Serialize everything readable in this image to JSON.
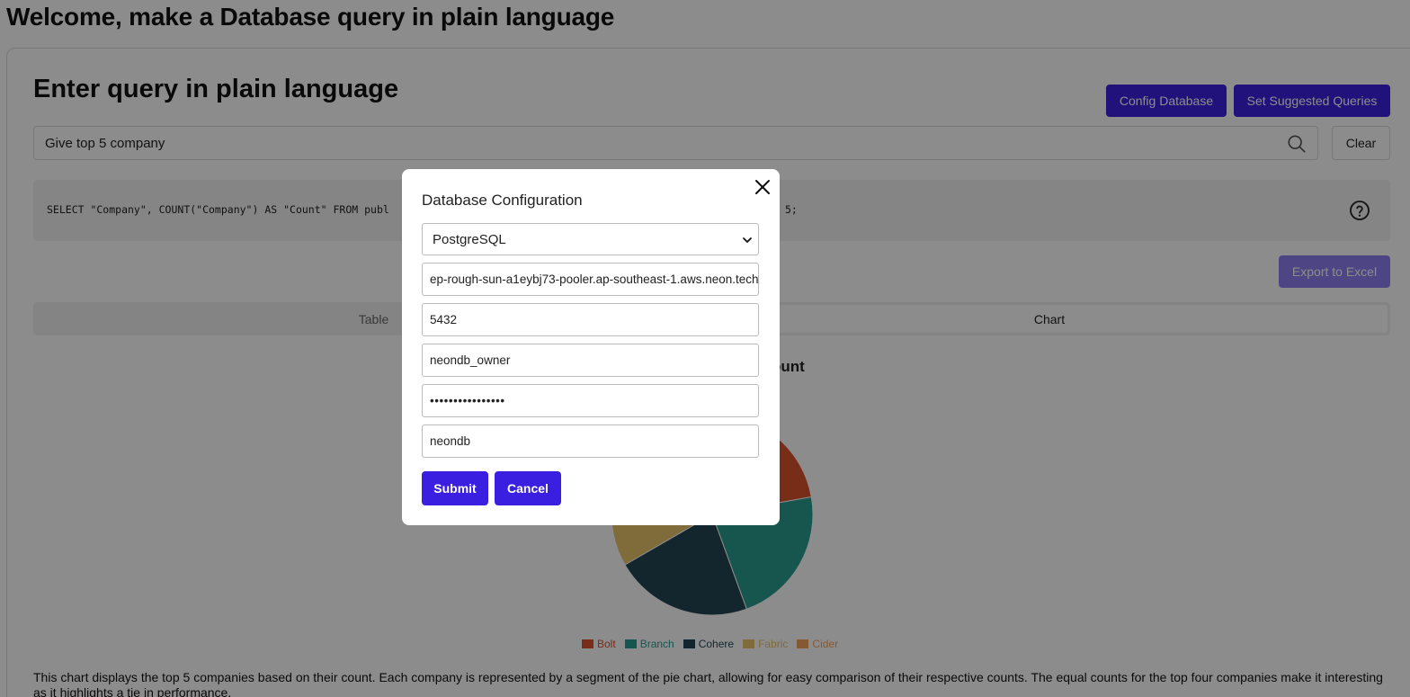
{
  "header": {
    "title": "Welcome, make a Database query in plain language"
  },
  "query_section": {
    "title": "Enter query in plain language",
    "config_button": "Config Database",
    "suggested_button": "Set Suggested Queries",
    "search_value": "Give top 5 company",
    "clear_button": "Clear",
    "sql_left": "SELECT \"Company\", COUNT(\"Company\") AS \"Count\" FROM publ",
    "sql_right": "5;",
    "export_button": "Export to Excel"
  },
  "tabs": {
    "table": "Table",
    "chart": "Chart"
  },
  "chart": {
    "title_fragment": "ount",
    "description": "This chart displays the top 5 companies based on their count. Each company is represented by a segment of the pie chart, allowing for easy comparison of their respective counts. The equal counts for the top four companies make it interesting as it highlights a tie in performance."
  },
  "chart_data": {
    "type": "pie",
    "categories": [
      "Bolt",
      "Branch",
      "Cohere",
      "Fabric",
      "Cider"
    ],
    "values": [
      2,
      2,
      2,
      2,
      1
    ],
    "colors": [
      "#d9532b",
      "#2a9d8f",
      "#264653",
      "#e9c46a",
      "#f4a261"
    ]
  },
  "modal": {
    "title": "Database Configuration",
    "db_type": "PostgreSQL",
    "host": "ep-rough-sun-a1eybj73-pooler.ap-southeast-1.aws.neon.tech",
    "port": "5432",
    "user": "neondb_owner",
    "password": "••••••••••••••••",
    "database": "neondb",
    "submit_button": "Submit",
    "cancel_button": "Cancel"
  }
}
